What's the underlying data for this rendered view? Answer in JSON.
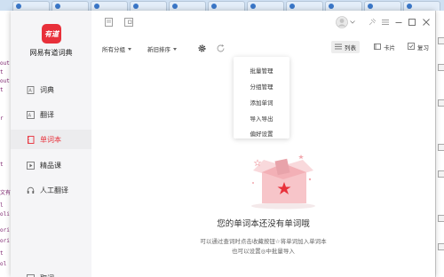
{
  "app": {
    "name": "网易有道词典",
    "logo_text": "有道"
  },
  "sidebar": {
    "items": [
      {
        "label": "词典"
      },
      {
        "label": "翻译"
      },
      {
        "label": "单词本"
      },
      {
        "label": "精品课"
      },
      {
        "label": "人工翻译"
      },
      {
        "label": "取词"
      }
    ]
  },
  "toolbar": {
    "group_filter": "所有分组",
    "sort_order": "新旧排序",
    "view_list": "列表",
    "view_card": "卡片",
    "review": "复习"
  },
  "menu": {
    "items": [
      "批量管理",
      "分组管理",
      "添加单词",
      "导入导出",
      "偏好设置"
    ]
  },
  "empty": {
    "title": "您的单词本还没有单词哦",
    "line1": "可以通过查词时点击收藏按钮☆将单词加入单词本",
    "line2": "也可以设置◎中批量导入"
  },
  "background": {
    "left_code": [
      "out",
      "t",
      "out",
      "t",
      "r",
      "t",
      "文有",
      "l",
      "oli",
      "ori",
      "ori",
      "t",
      "ol"
    ]
  },
  "colors": {
    "brand": "#e8303a",
    "illustration": "#f7c5c9"
  }
}
